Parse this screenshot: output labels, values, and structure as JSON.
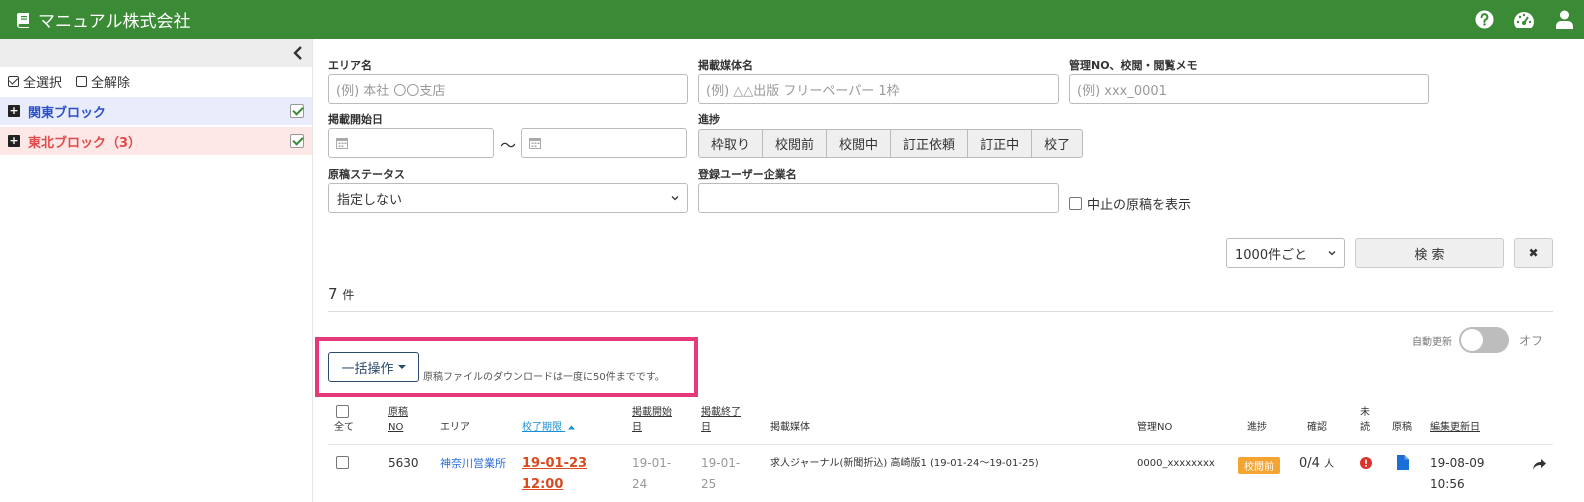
{
  "app": {
    "company": "マニュアル株式会社"
  },
  "header": {
    "icons": [
      "help-icon",
      "dashboard-icon",
      "user-icon"
    ]
  },
  "sidebar": {
    "select_all": "全選択",
    "deselect_all": "全解除",
    "groups": [
      {
        "label": "関東ブロック",
        "checked": true
      },
      {
        "label": "東北ブロック（3）",
        "checked": true
      }
    ]
  },
  "filters": {
    "area": {
      "label": "エリア名",
      "placeholder": "(例) 本社 〇〇支店"
    },
    "media": {
      "label": "掲載媒体名",
      "placeholder": "(例) △△出版 フリーペーパー 1枠"
    },
    "mgmt": {
      "label": "管理NO、校閲・閲覧メモ",
      "placeholder": "(例) xxx_0001"
    },
    "start_date": {
      "label": "掲載開始日",
      "separator": "〜"
    },
    "progress": {
      "label": "進捗",
      "options": [
        "枠取り",
        "校閲前",
        "校閲中",
        "訂正依頼",
        "訂正中",
        "校了"
      ]
    },
    "status": {
      "label": "原稿ステータス",
      "value": "指定しない"
    },
    "company": {
      "label": "登録ユーザー企業名",
      "value": ""
    },
    "show_cancelled": "中止の原稿を表示",
    "per_page": "1000件ごと",
    "search": "検 索",
    "clear": "✖"
  },
  "results": {
    "count": "7",
    "unit": "件",
    "auto_update_label": "自動更新",
    "auto_update_state": "オフ",
    "bulk_label": "一括操作",
    "download_note": "原稿ファイルのダウンロードは一度に50件までです。"
  },
  "table": {
    "headers": {
      "all": "全て",
      "no_1": "原稿",
      "no_2": "NO",
      "area": "エリア",
      "deadline": "校了期限",
      "start_1": "掲載開始",
      "start_2": "日",
      "end_1": "掲載終了",
      "end_2": "日",
      "media": "掲載媒体",
      "mgmt": "管理NO",
      "progress": "進捗",
      "confirm": "確認",
      "unread_1": "未",
      "unread_2": "読",
      "manuscript": "原稿",
      "updated": "編集更新日"
    },
    "rows": [
      {
        "no": "5630",
        "area": "神奈川営業所",
        "deadline_1": "19-01-23",
        "deadline_2": "12:00",
        "start_1": "19-01-",
        "start_2": "24",
        "end_1": "19-01-",
        "end_2": "25",
        "media": "求人ジャーナル(新聞折込) 高崎版1 (19-01-24〜19-01-25)",
        "mgmt": "0000_xxxxxxxx",
        "progress": "校閲前",
        "confirm_count": "0/4",
        "confirm_unit": "人",
        "updated_1": "19-08-09",
        "updated_2": "10:56"
      }
    ]
  },
  "colors": {
    "header_bg": "#3a8a36",
    "highlight": "#e6397a",
    "kanto": "#2b50c8",
    "tohoku": "#e04a4a",
    "badge": "#f4a431"
  }
}
